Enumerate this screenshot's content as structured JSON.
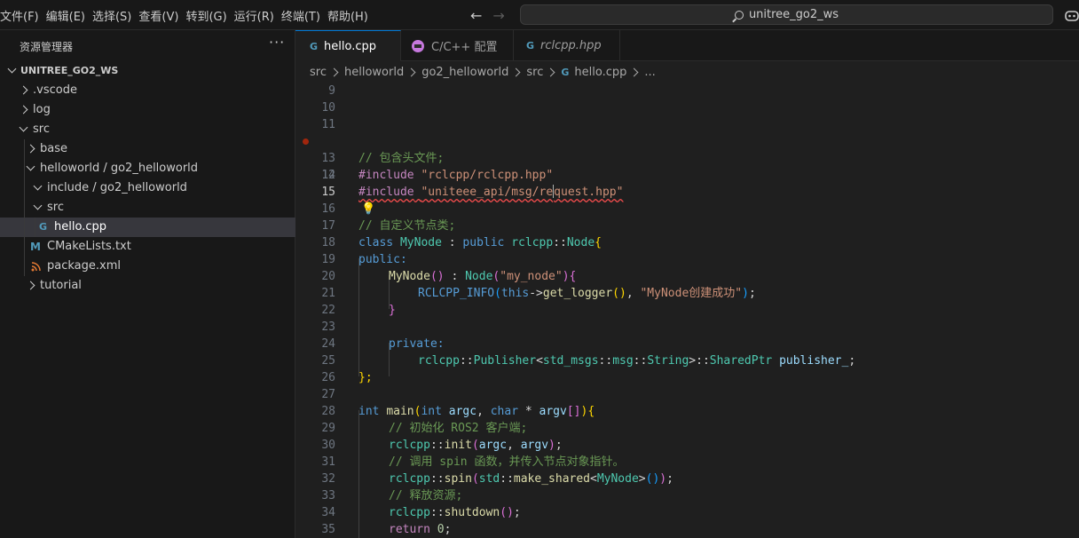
{
  "menu": [
    "文件(F)",
    "编辑(E)",
    "选择(S)",
    "查看(V)",
    "转到(G)",
    "运行(R)",
    "终端(T)",
    "帮助(H)"
  ],
  "search": {
    "text": "unitree_go2_ws"
  },
  "sidebar": {
    "title": "资源管理器",
    "more": "···",
    "root": "UNITREE_GO2_WS",
    "items": [
      {
        "label": ".vscode"
      },
      {
        "label": "log"
      },
      {
        "label": "src"
      },
      {
        "label": "base"
      },
      {
        "label": "helloworld / go2_helloworld"
      },
      {
        "label": "include / go2_helloworld"
      },
      {
        "label": "src"
      },
      {
        "label": "hello.cpp",
        "icon": "G"
      },
      {
        "label": "CMakeLists.txt",
        "icon": "M"
      },
      {
        "label": "package.xml",
        "icon": "rss"
      },
      {
        "label": "tutorial"
      }
    ]
  },
  "tabs": [
    {
      "label": "hello.cpp",
      "icon": "G"
    },
    {
      "label": "C/C++ 配置"
    },
    {
      "label": "rclcpp.hpp",
      "icon": "G"
    }
  ],
  "breadcrumb": [
    "src",
    "helloworld",
    "go2_helloworld",
    "src",
    "hello.cpp",
    "..."
  ],
  "bc_icon": "G",
  "editor": {
    "line_numbers": [
      "9",
      "10",
      "11",
      "12",
      "13",
      "14",
      "15",
      "16",
      "17",
      "18",
      "19",
      "20",
      "21",
      "22",
      "23",
      "24",
      "25",
      "26",
      "27",
      "28",
      "29",
      "30",
      "31",
      "32",
      "33",
      "34",
      "35"
    ],
    "bulb": "💡",
    "code": {
      "l13": "// 包含头文件;",
      "l14_kw": "#include",
      "l14_str": "\"rclcpp/rclcpp.hpp\"",
      "l15_kw": "#include",
      "l15_str_a": "\"uniteee_api/msg/re",
      "l15_str_b": "quest.hpp\"",
      "l17": "// 自定义节点类;",
      "l18_class": "class",
      "l18_name": "MyNode",
      "l18_colon": " : ",
      "l18_public": "public",
      "l18_ns": "rclcpp",
      "l18_sep": "::",
      "l18_base": "Node",
      "l18_brace": "{",
      "l19": "public:",
      "l20_fn": "MyNode",
      "l20_p": "()",
      "l20_colon": " : ",
      "l20_base": "Node",
      "l20_po": "(",
      "l20_str": "\"my_node\"",
      "l20_pc": ")",
      "l20_brace": "{",
      "l21_macro": "RCLCPP_INFO",
      "l21_po": "(",
      "l21_this": "this",
      "l21_arrow": "->",
      "l21_fn": "get_logger",
      "l21_p": "()",
      "l21_comma": ", ",
      "l21_str": "\"MyNode创建成功\"",
      "l21_pc": ")",
      "l21_semi": ";",
      "l22": "}",
      "l24": "private:",
      "l25_ns": "rclcpp",
      "l25_sep": "::",
      "l25_pub": "Publisher",
      "l25_lt": "<",
      "l25_ns2": "std_msgs",
      "l25_sep2": "::",
      "l25_ns3": "msg",
      "l25_sep3": "::",
      "l25_str": "String",
      "l25_gt": ">::",
      "l25_sp": "SharedPtr",
      "l25_var": "publisher_",
      "l25_semi": ";",
      "l26": "};",
      "l28_int": "int",
      "l28_fn": "main",
      "l28_po": "(",
      "l28_int2": "int",
      "l28_argc": "argc",
      "l28_comma": ", ",
      "l28_char": "char",
      "l28_star": " * ",
      "l28_argv": "argv",
      "l28_br": "[]",
      "l28_pc": ")",
      "l28_brace": "{",
      "l29": "// 初始化 ROS2 客户端;",
      "l30_ns": "rclcpp",
      "l30_sep": "::",
      "l30_fn": "init",
      "l30_po": "(",
      "l30_argc": "argc",
      "l30_comma": ", ",
      "l30_argv": "argv",
      "l30_pc": ")",
      "l30_semi": ";",
      "l31": "// 调用 spin 函数，并传入节点对象指针。",
      "l32_ns": "rclcpp",
      "l32_sep": "::",
      "l32_fn": "spin",
      "l32_po": "(",
      "l32_std": "std",
      "l32_sep2": "::",
      "l32_fn2": "make_shared",
      "l32_lt": "<",
      "l32_type": "MyNode",
      "l32_gt": ">",
      "l32_p": "()",
      "l32_pc": ")",
      "l32_semi": ";",
      "l33": "// 释放资源;",
      "l34_ns": "rclcpp",
      "l34_sep": "::",
      "l34_fn": "shutdown",
      "l34_p": "()",
      "l34_semi": ";",
      "l35_ret": "return",
      "l35_num": "0",
      "l35_semi": ";"
    }
  }
}
